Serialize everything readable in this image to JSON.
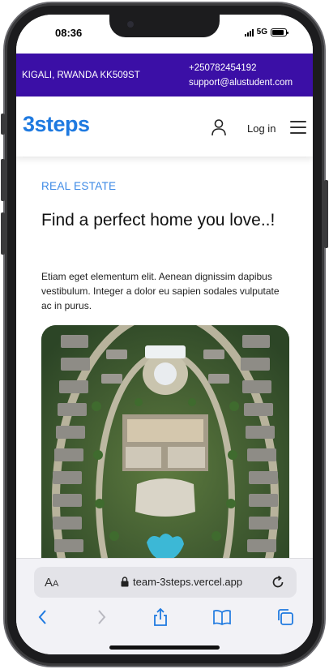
{
  "status": {
    "time": "08:36",
    "network": "5G",
    "battery_level": 0.9
  },
  "topbar": {
    "location": "KIGALI, RWANDA KK509ST",
    "phone": "+250782454192",
    "email": "support@alustudent.com"
  },
  "header": {
    "logo": "3steps",
    "login_label": "Log in"
  },
  "hero": {
    "eyebrow": "REAL ESTATE",
    "title": "Find a perfect home you love..!",
    "description": "Etiam eget elementum elit. Aenean dignissim dapibus vestibulum. Integer a dolor eu sapien sodales vulputate ac in purus."
  },
  "browser": {
    "text_size_label": "AA",
    "url": "team-3steps.vercel.app"
  },
  "colors": {
    "topbar": "#3b0fa6",
    "brand": "#1f7ae0",
    "eyebrow": "#3d8ae6"
  },
  "icons": [
    "user-icon",
    "menu-icon",
    "lock-icon",
    "reload-icon",
    "back-icon",
    "forward-icon",
    "share-icon",
    "bookmarks-icon",
    "tabs-icon"
  ]
}
